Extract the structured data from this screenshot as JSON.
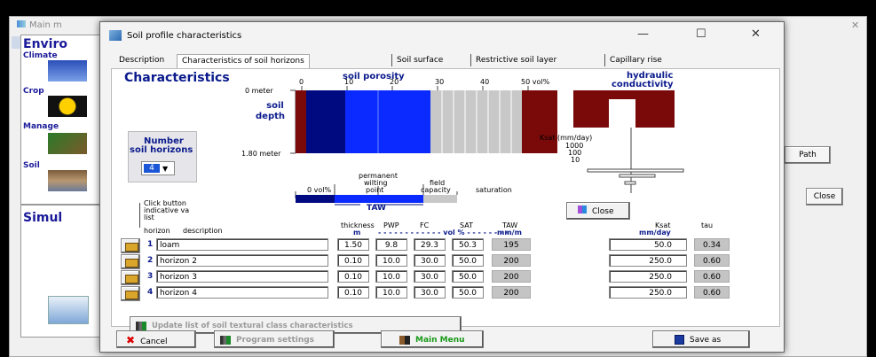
{
  "main_window": {
    "title": "Main m",
    "side_labels": {
      "environment": "Enviro",
      "climate": "Climate",
      "crop": "Crop",
      "management": "Manage",
      "soil": "Soil",
      "simulation": "Simul"
    },
    "path_button": "Path",
    "close_button": "Close"
  },
  "dialog": {
    "title": "Soil profile characteristics",
    "window_controls": {
      "minimize": "—",
      "maximize": "☐",
      "close": "✕"
    },
    "tabs": [
      {
        "label": "Description"
      },
      {
        "label": "Characteristics of soil horizons"
      },
      {
        "label": "Soil surface"
      },
      {
        "label": "Restrictive soil layer"
      },
      {
        "label": "Capillary rise"
      }
    ],
    "active_tab": 1,
    "characteristics_heading": "Characteristics",
    "porosity": {
      "title": "soil porosity",
      "ticks": [
        "0",
        "10",
        "20",
        "30",
        "40",
        "50 vol%"
      ],
      "depth_top": "0 meter",
      "depth_label_1": "soil",
      "depth_label_2": "depth",
      "depth_bottom": "1.80 meter"
    },
    "hydraulic": {
      "title_1": "hydraulic",
      "title_2": "conductivity",
      "ksat_label": "Ksat (mm/day)",
      "ksat_ticks": [
        "1000",
        "100",
        "10"
      ]
    },
    "number_horizons": {
      "label_1": "Number",
      "label_2": "soil horizons",
      "value": "4"
    },
    "taw_legend": {
      "vol_label": "0 vol%",
      "pwp_1": "permanent",
      "pwp_2": "wilting",
      "pwp_3": "point",
      "fc_1": "field",
      "fc_2": "capacity",
      "sat": "saturation",
      "taw": "TAW"
    },
    "close_button": "Close",
    "hint": {
      "line1": "Click button",
      "line2": "indicative va",
      "line3": "list"
    },
    "table": {
      "headers": {
        "horizon": "horizon",
        "description": "description",
        "thickness": "thickness",
        "thickness_unit": "m",
        "pwp": "PWP",
        "fc": "FC",
        "sat": "SAT",
        "vol_unit": "vol %",
        "taw": "TAW",
        "taw_unit": "mm/m",
        "ksat": "Ksat",
        "ksat_unit": "mm/day",
        "tau": "tau"
      },
      "rows": [
        {
          "n": "1",
          "description": "loam",
          "thickness": "1.50",
          "pwp": "9.8",
          "fc": "29.3",
          "sat": "50.3",
          "taw": "195",
          "ksat": "50.0",
          "tau": "0.34"
        },
        {
          "n": "2",
          "description": "horizon 2",
          "thickness": "0.10",
          "pwp": "10.0",
          "fc": "30.0",
          "sat": "50.0",
          "taw": "200",
          "ksat": "250.0",
          "tau": "0.60"
        },
        {
          "n": "3",
          "description": "horizon 3",
          "thickness": "0.10",
          "pwp": "10.0",
          "fc": "30.0",
          "sat": "50.0",
          "taw": "200",
          "ksat": "250.0",
          "tau": "0.60"
        },
        {
          "n": "4",
          "description": "horizon 4",
          "thickness": "0.10",
          "pwp": "10.0",
          "fc": "30.0",
          "sat": "50.0",
          "taw": "200",
          "ksat": "250.0",
          "tau": "0.60"
        }
      ]
    },
    "update_button": "Update list of soil textural class characteristics",
    "bottom_buttons": {
      "cancel": "Cancel",
      "program_settings": "Program settings",
      "main_menu": "Main Menu",
      "save_as": "Save as"
    },
    "colors": {
      "pwp_dark_blue": "#000a80",
      "taw_blue": "#0a2aff",
      "drainable_grey": "#c8c8c8",
      "saturation_maroon": "#7a0a0a",
      "heading_blue": "#0a1a8c"
    }
  }
}
